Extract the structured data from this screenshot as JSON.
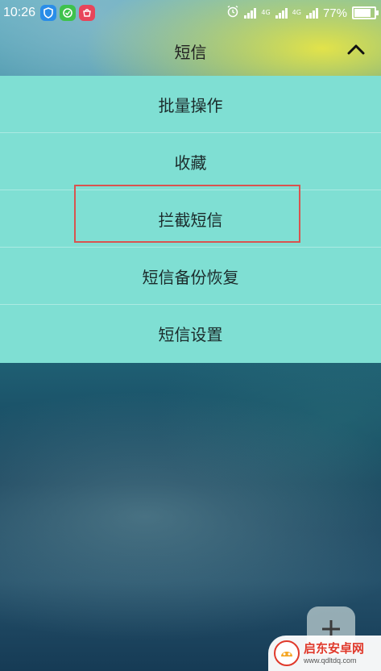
{
  "status_bar": {
    "time": "10:26",
    "battery_text": "77%",
    "battery_level": 0.77,
    "net1": "4G",
    "net2": "4G",
    "icons": [
      "shield-app-icon",
      "green-app-icon",
      "red-app-icon",
      "alarm-icon",
      "signal-icon",
      "signal-4g-icon",
      "battery-icon"
    ]
  },
  "header": {
    "title": "短信",
    "collapse_icon": "chevron-up-icon"
  },
  "menu": {
    "items": [
      {
        "label": "批量操作"
      },
      {
        "label": "收藏"
      },
      {
        "label": "拦截短信"
      },
      {
        "label": "短信备份恢复"
      },
      {
        "label": "短信设置"
      }
    ]
  },
  "fab": {
    "icon": "compose-icon"
  },
  "watermark": {
    "name": "启东安卓网",
    "url": "www.qdltdq.com",
    "logo": "watermark-logo-icon"
  },
  "colors": {
    "menu_bg": "#7fdfd3",
    "highlight": "#d9534f",
    "watermark_red": "#e0392b"
  }
}
